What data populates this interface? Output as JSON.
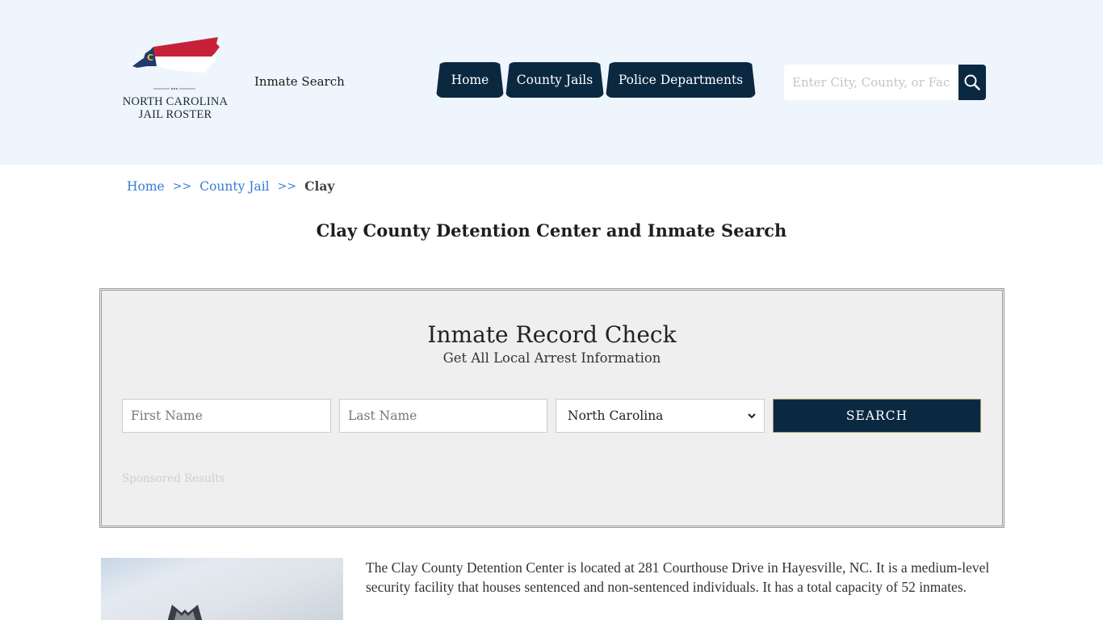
{
  "header": {
    "logo": {
      "line1": "NORTH CAROLINA",
      "line2": "JAIL ROSTER",
      "flag_letter": "C",
      "colors": {
        "red": "#c8203a",
        "blue": "#223a6b",
        "white": "#ffffff",
        "gold": "#e3c12a"
      }
    },
    "inmate_search_link": "Inmate Search",
    "nav": [
      {
        "label": "Home"
      },
      {
        "label": "County Jails"
      },
      {
        "label": "Police Departments"
      }
    ],
    "search": {
      "placeholder": "Enter City, County, or Facility",
      "value": ""
    }
  },
  "breadcrumb": {
    "items": [
      {
        "label": "Home"
      },
      {
        "label": "County Jail"
      }
    ],
    "separator": ">>",
    "current": "Clay"
  },
  "page_title": "Clay County Detention Center and Inmate Search",
  "record_check": {
    "title": "Inmate Record Check",
    "subtitle": "Get All Local Arrest Information",
    "first_name_placeholder": "First Name",
    "last_name_placeholder": "Last Name",
    "state_selected": "North Carolina",
    "submit_label": "SEARCH",
    "sponsored_label": "Sponsored Results"
  },
  "facility": {
    "description": "The Clay County Detention Center is located at 281 Courthouse Drive in Hayesville, NC. It is a medium-level security facility that houses sentenced and non-sentenced individuals. It has a total capacity of 52 inmates."
  },
  "colors": {
    "header_bg": "#eef5fd",
    "nav_bg": "#0b2841",
    "link": "#3a7bd5",
    "panel_bg": "#efefef"
  }
}
